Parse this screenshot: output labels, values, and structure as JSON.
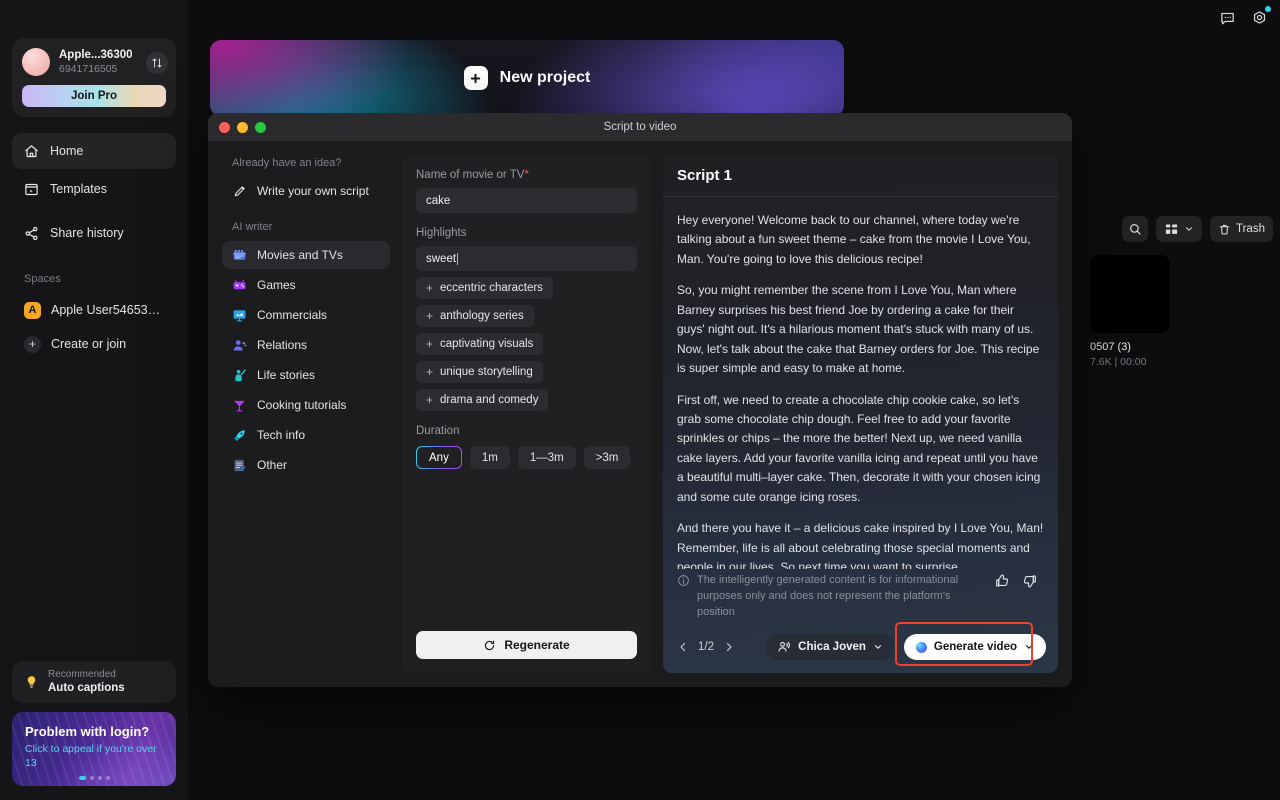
{
  "account": {
    "name": "Apple...36300",
    "id": "6941716505",
    "join_label": "Join Pro",
    "swap_icon": "swap-icon"
  },
  "sidebar": {
    "nav": [
      {
        "label": "Home",
        "icon": "home-icon",
        "active": true
      },
      {
        "label": "Templates",
        "icon": "templates-icon",
        "active": false
      },
      {
        "label": "Share history",
        "icon": "share-icon",
        "active": false
      }
    ],
    "spaces_label": "Spaces",
    "spaces": [
      {
        "badge": "A",
        "label": "Apple User546536..."
      }
    ],
    "create_or_join": "Create or join",
    "recommend": {
      "eyebrow": "Recommended",
      "title": "Auto captions",
      "icon": "lightbulb-icon"
    },
    "promo": {
      "title": "Problem with login?",
      "subtitle": "Click to appeal if you're over 13"
    }
  },
  "topbar": {
    "feedback_icon": "message-icon",
    "settings_icon": "gear-icon"
  },
  "banner": {
    "label": "New project",
    "icon": "plus-icon"
  },
  "assets": {
    "toolbar": {
      "search_icon": "search-icon",
      "layout_icon": "grid-layout-icon",
      "trash_label": "Trash",
      "trash_icon": "trash-icon"
    },
    "items": [
      {
        "title": "0507 (3)",
        "meta": "7.6K | 00:00"
      }
    ]
  },
  "modal": {
    "title": "Script to video",
    "nav": {
      "idea_label": "Already have an idea?",
      "own_script": {
        "label": "Write your own script",
        "icon": "pencil-icon"
      },
      "ai_writer_label": "AI writer",
      "categories": [
        {
          "label": "Movies and TVs",
          "icon": "clapperboard-icon",
          "active": true
        },
        {
          "label": "Games",
          "icon": "gamepad-icon",
          "active": false
        },
        {
          "label": "Commercials",
          "icon": "presentation-icon",
          "active": false
        },
        {
          "label": "Relations",
          "icon": "people-icon",
          "active": false
        },
        {
          "label": "Life stories",
          "icon": "person-wave-icon",
          "active": false
        },
        {
          "label": "Cooking tutorials",
          "icon": "cocktail-icon",
          "active": false
        },
        {
          "label": "Tech info",
          "icon": "rocket-icon",
          "active": false
        },
        {
          "label": "Other",
          "icon": "document-icon",
          "active": false
        }
      ]
    },
    "form": {
      "name_label": "Name of movie or TV",
      "name_required": "*",
      "name_value": "cake",
      "highlights_label": "Highlights",
      "highlights_value": "sweet",
      "highlight_suggestions": [
        "eccentric characters",
        "anthology series",
        "captivating visuals",
        "unique storytelling",
        "drama and comedy"
      ],
      "duration_label": "Duration",
      "durations": [
        {
          "label": "Any",
          "selected": true
        },
        {
          "label": "1m",
          "selected": false
        },
        {
          "label": "1—3m",
          "selected": false
        },
        {
          "label": ">3m",
          "selected": false
        }
      ],
      "regenerate_label": "Regenerate",
      "regenerate_icon": "refresh-icon"
    },
    "script": {
      "heading": "Script 1",
      "paragraphs": [
        "Hey everyone! Welcome back to our channel, where today we're talking about a fun sweet theme – cake from the movie I Love You, Man. You're going to love this delicious recipe!",
        "So, you might remember the scene from I Love You, Man where Barney surprises his best friend Joe by ordering a cake for their guys' night out. It's a hilarious moment that's stuck with many of us. Now, let's talk about the cake that Barney orders for Joe. This recipe is super simple and easy to make at home.",
        "First off, we need to create a chocolate chip cookie cake, so let's grab some chocolate chip dough. Feel free to add your favorite sprinkles or chips – the more the better! Next up, we need vanilla cake layers. Add your favorite vanilla icing and repeat until you have a beautiful multi–layer cake. Then, decorate it with your chosen icing and some cute orange icing roses.",
        "And there you have it – a delicious cake inspired by I Love You, Man! Remember, life is all about celebrating those special moments and people in our lives. So next time you want to surprise"
      ],
      "disclaimer": "The intelligently generated content is for informational purposes only and does not represent the platform's position",
      "disclaimer_icon": "info-icon",
      "like_icon": "thumbs-up-icon",
      "dislike_icon": "thumbs-down-icon",
      "pager": "1/2",
      "prev_icon": "chevron-left-icon",
      "next_icon": "chevron-right-icon",
      "voice_label": "Chica Joven",
      "voice_icon": "voice-icon",
      "voice_caret": "chevron-down-icon",
      "generate_label": "Generate video",
      "generate_caret": "chevron-down-icon"
    }
  },
  "colors": {
    "accent_cyan": "#2ad4f0",
    "highlight_red": "#f0402a",
    "required_red": "#ff4d4f",
    "space_badge": "#f5a623"
  }
}
